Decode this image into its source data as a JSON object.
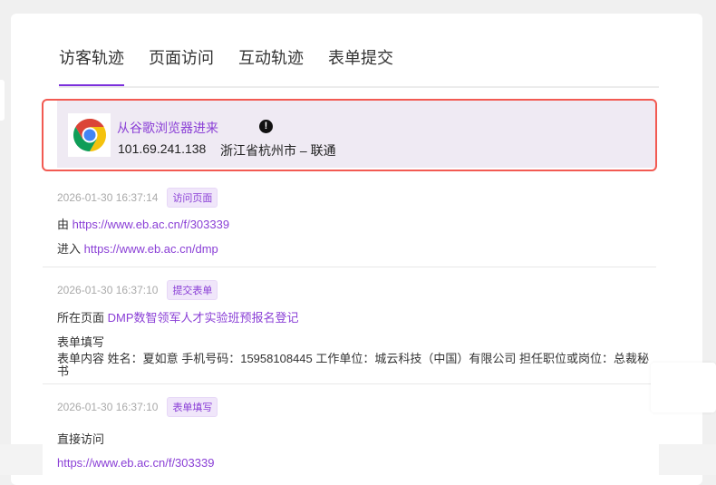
{
  "tabs": [
    {
      "label": "访客轨迹"
    },
    {
      "label": "页面访问"
    },
    {
      "label": "互动轨迹"
    },
    {
      "label": "表单提交"
    }
  ],
  "visitor": {
    "source": "从谷歌浏览器进来",
    "ip": "101.69.241.138",
    "location": "浙江省杭州市 – 联通",
    "browser_icon": "chrome-icon",
    "warn_icon": "!"
  },
  "entries": [
    {
      "time": "2026-01-30 16:37:14",
      "badge": "访问页面",
      "from_label": "由",
      "from_url": "https://www.eb.ac.cn/f/303339",
      "to_label": "进入",
      "to_url": "https://www.eb.ac.cn/dmp"
    },
    {
      "time": "2026-01-30 16:37:10",
      "badge": "提交表单",
      "page_label": "所在页面",
      "page_name": "DMP数智领军人才实验班预报名登记",
      "form_title": "表单填写",
      "form_content": "表单内容 姓名：夏如意 手机号码：15958108445 工作单位：城云科技（中国）有限公司 担任职位或岗位：总裁秘书"
    },
    {
      "time": "2026-01-30 16:37:10",
      "badge": "表单填写",
      "access": "直接访问",
      "url": "https://www.eb.ac.cn/f/303339"
    }
  ]
}
